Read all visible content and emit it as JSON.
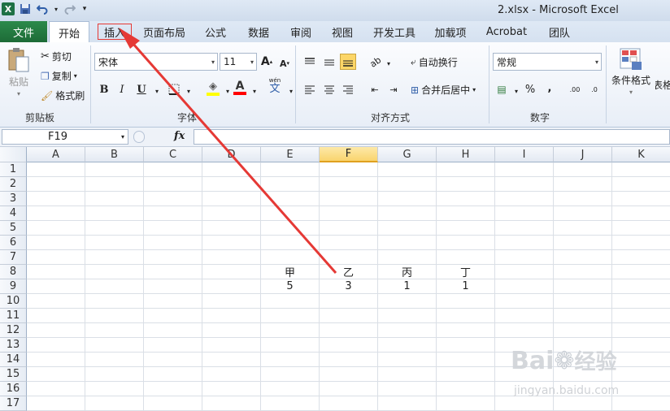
{
  "window": {
    "title": "2.xlsx  -  Microsoft Excel"
  },
  "qat": {
    "excel_icon": "X",
    "save_icon": "save-icon",
    "undo_icon": "undo-icon",
    "redo_icon": "redo-icon",
    "customize_icon": "customize-icon"
  },
  "tabs": {
    "file": "文件",
    "items": [
      "开始",
      "插入",
      "页面布局",
      "公式",
      "数据",
      "审阅",
      "视图",
      "开发工具",
      "加载项",
      "Acrobat",
      "团队"
    ],
    "active": "开始",
    "highlighted": "插入"
  },
  "ribbon": {
    "clipboard": {
      "paste": "粘贴",
      "cut": "剪切",
      "copy": "复制",
      "format_painter": "格式刷",
      "label": "剪贴板"
    },
    "font": {
      "name": "宋体",
      "size": "11",
      "grow": "A",
      "shrink": "A",
      "bold": "B",
      "italic": "I",
      "underline": "U",
      "fill_letter": "A",
      "font_color_letter": "A",
      "phonetic": "wén",
      "phonetic_char": "文",
      "label": "字体"
    },
    "alignment": {
      "wrap": "自动换行",
      "merge": "合并后居中",
      "label": "对齐方式"
    },
    "number": {
      "format": "常规",
      "percent": "%",
      "comma": ",",
      "inc_dec": ".00",
      "dec_dec": ".0",
      "label": "数字"
    },
    "styles": {
      "conditional": "条件格式",
      "table_partial": "表格"
    }
  },
  "formula_bar": {
    "name_box": "F19",
    "fx": "fx",
    "value": ""
  },
  "sheet": {
    "columns": [
      "A",
      "B",
      "C",
      "D",
      "E",
      "F",
      "G",
      "H",
      "I",
      "J",
      "K"
    ],
    "selected_column": "F",
    "rows": [
      "1",
      "2",
      "3",
      "4",
      "5",
      "6",
      "7",
      "8",
      "9",
      "10",
      "11",
      "12",
      "13",
      "14",
      "15",
      "16",
      "17"
    ],
    "row8": {
      "E": "甲",
      "F": "乙",
      "G": "丙",
      "H": "丁"
    },
    "row9": {
      "E": "5",
      "F": "3",
      "G": "1",
      "H": "1"
    }
  },
  "watermark": {
    "brand": "Bai",
    "brand2": "经验",
    "url": "jingyan.baidu.com"
  },
  "colors": {
    "accent_green": "#1e7145",
    "arrow_red": "#e53935",
    "selected_header": "#f9d46e"
  }
}
